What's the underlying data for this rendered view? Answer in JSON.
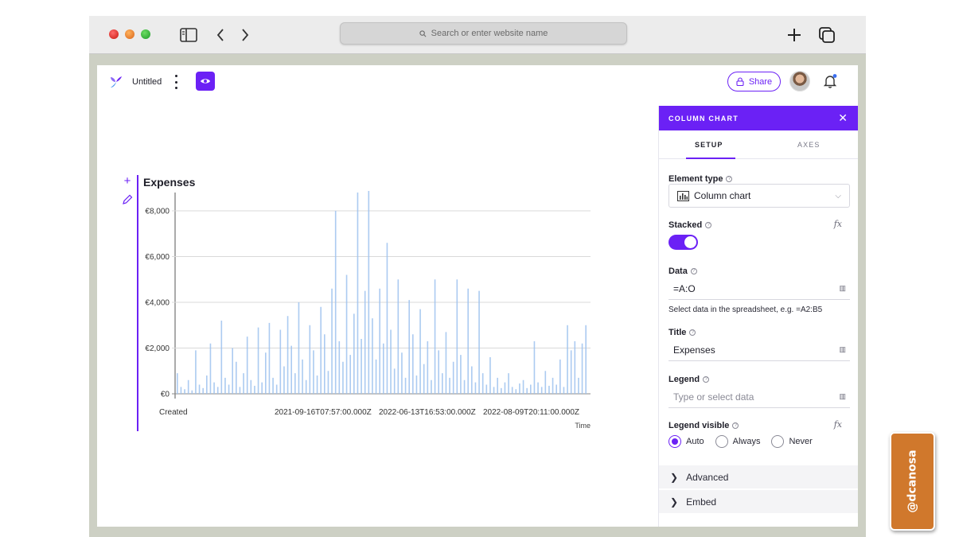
{
  "browser": {
    "url_placeholder": "Search or enter website name"
  },
  "app": {
    "doc_title": "Untitled",
    "share_label": "Share",
    "accent_color": "#6b21f5"
  },
  "chart_data": {
    "type": "bar",
    "title": "Expenses",
    "xlabel": "Time",
    "ylabel": "",
    "x_tick_labels": [
      "Created",
      "2021-09-16T07:57:00.000Z",
      "2022-06-13T16:53:00.000Z",
      "2022-08-09T20:11:00.000Z"
    ],
    "y_tick_labels": [
      "€0",
      "€2,000",
      "€4,000",
      "€6,000",
      "€8,000"
    ],
    "ylim": [
      0,
      8800
    ],
    "grid": true,
    "stacked": true,
    "series": [
      {
        "color": "#9ec2ee",
        "values": [
          900,
          300,
          200,
          600,
          150,
          1900,
          400,
          250,
          800,
          2200,
          500,
          300,
          3200,
          700,
          400,
          2000,
          1400,
          300,
          900,
          2500,
          600,
          350,
          2900,
          500,
          1800,
          3100,
          700,
          400,
          2800,
          1200,
          3400,
          2100,
          900,
          4000,
          1500,
          600,
          3000,
          1900,
          800,
          3800,
          2600,
          1000,
          4600,
          8000,
          2300,
          1400,
          5200,
          1700,
          3500,
          8800,
          2400,
          4500,
          8900,
          3300,
          1500,
          4600,
          2200,
          6600,
          2800,
          1100,
          5000,
          1800,
          700,
          4100,
          2600,
          800,
          3700,
          1300,
          2300,
          600,
          5000,
          1900,
          900,
          2700,
          700,
          1400,
          5000,
          1700,
          600,
          4600,
          1200,
          500,
          4500,
          900,
          400,
          1600,
          300,
          700,
          250,
          500,
          900,
          300,
          200,
          450,
          600,
          250,
          400,
          2300,
          500,
          300,
          1000,
          350,
          700,
          400,
          1500,
          300,
          3000,
          1900,
          2300,
          700,
          2200,
          3000
        ]
      }
    ]
  },
  "panel": {
    "header_title": "COLUMN CHART",
    "tabs": [
      "SETUP",
      "AXES"
    ],
    "element_type_label": "Element type",
    "element_type_value": "Column chart",
    "stacked_label": "Stacked",
    "stacked_on": true,
    "data_label": "Data",
    "data_value": "=A:O",
    "data_helper": "Select data in the spreadsheet, e.g. =A2:B5",
    "title_label": "Title",
    "title_value": "Expenses",
    "legend_label": "Legend",
    "legend_placeholder": "Type or select data",
    "legend_visible_label": "Legend visible",
    "legend_options": [
      "Auto",
      "Always",
      "Never"
    ],
    "legend_selected": "Auto",
    "fx_label": "fx",
    "sections": [
      "Advanced",
      "Embed"
    ]
  },
  "watermark": {
    "handle": "@dcanosa"
  }
}
